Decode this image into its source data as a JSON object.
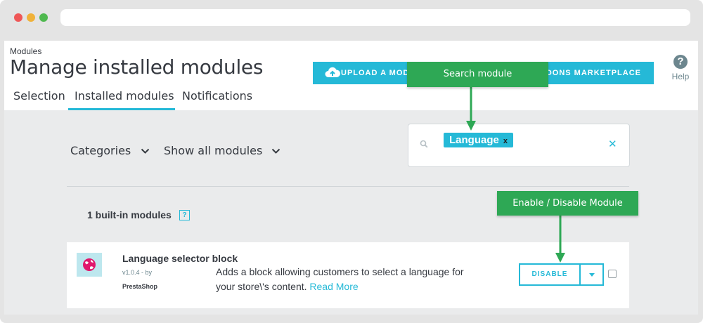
{
  "browser": {
    "dots": [
      "#ef5757",
      "#f0b23a",
      "#4fb94f"
    ]
  },
  "header": {
    "breadcrumb": "Modules",
    "title": "Manage installed modules",
    "upload_label": "UPLOAD A MOD",
    "marketplace_label": "DDONS MARKETPLACE",
    "help_label": "Help",
    "help_symbol": "?"
  },
  "tabs": [
    {
      "label": "Selection",
      "active": false
    },
    {
      "label": "Installed modules",
      "active": true
    },
    {
      "label": "Notifications",
      "active": false
    }
  ],
  "filters": {
    "categories": "Categories",
    "show": "Show all modules"
  },
  "search": {
    "tag": "Language",
    "tag_remove": "x",
    "clear": "✕"
  },
  "section": {
    "title": "1 built-in modules",
    "help": "?"
  },
  "module": {
    "name": "Language selector block",
    "version": "v1.0.4 - by",
    "author": "PrestaShop",
    "description": "Adds a block allowing customers to select a language for your store\\'s content.",
    "read_more": "Read More",
    "action_label": "DISABLE",
    "checked": false
  },
  "annotations": {
    "search_tip": "Search module",
    "enable_tip": "Enable / Disable Module"
  },
  "colors": {
    "accent": "#25b9d7",
    "annotation": "#2ea855",
    "text": "#363a41",
    "background": "#eaebec"
  }
}
